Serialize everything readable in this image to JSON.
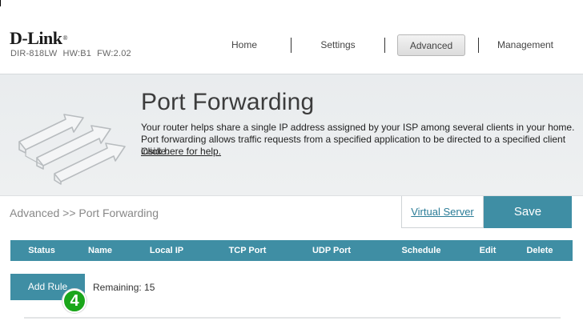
{
  "brand": {
    "logo": "D-Link",
    "registered_mark": "®",
    "model": "DIR-818LW",
    "hw": "HW:B1",
    "fw": "FW:2.02"
  },
  "nav": {
    "home": "Home",
    "settings": "Settings",
    "advanced": "Advanced",
    "management": "Management",
    "active": "Advanced"
  },
  "hero": {
    "title": "Port Forwarding",
    "description": "Your router helps share a single IP address assigned by your ISP among several clients in your home. Port forwarding allows traffic requests from a specified application to be directed to a specified client inside.",
    "help_link": "Click here for help."
  },
  "breadcrumb": "Advanced >> Port Forwarding",
  "actions": {
    "virtual_server": "Virtual Server",
    "save": "Save"
  },
  "table": {
    "columns": [
      "Status",
      "Name",
      "Local IP",
      "TCP Port",
      "UDP Port",
      "Schedule",
      "Edit",
      "Delete"
    ]
  },
  "rules": {
    "add_rule": "Add Rule",
    "remaining": "Remaining: 15"
  },
  "annotation": {
    "step": "4"
  },
  "colors": {
    "accent": "#3f8ea4",
    "link": "#2a7c97",
    "badge": "#1aa61a"
  }
}
